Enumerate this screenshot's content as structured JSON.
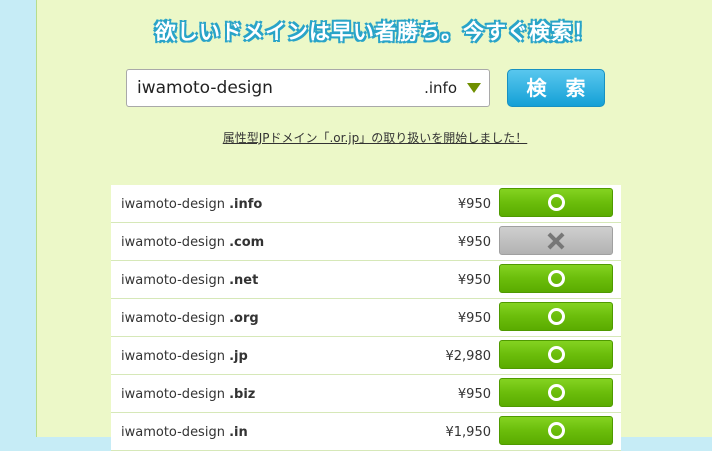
{
  "headline": "欲しいドメインは早い者勝ち。今すぐ検索！",
  "search": {
    "value": "iwamoto-design",
    "selected_tld": ".info",
    "button_label": "検 索"
  },
  "notice_link": "属性型JPドメイン「.or.jp」の取り扱いを開始しました！",
  "results": [
    {
      "name": "iwamoto-design",
      "tld": ".info",
      "price": "¥950",
      "available": true
    },
    {
      "name": "iwamoto-design",
      "tld": ".com",
      "price": "¥950",
      "available": false
    },
    {
      "name": "iwamoto-design",
      "tld": ".net",
      "price": "¥950",
      "available": true
    },
    {
      "name": "iwamoto-design",
      "tld": ".org",
      "price": "¥950",
      "available": true
    },
    {
      "name": "iwamoto-design",
      "tld": ".jp",
      "price": "¥2,980",
      "available": true
    },
    {
      "name": "iwamoto-design",
      "tld": ".biz",
      "price": "¥950",
      "available": true
    },
    {
      "name": "iwamoto-design",
      "tld": ".in",
      "price": "¥1,950",
      "available": true
    }
  ],
  "icons": {
    "available": "circle-icon",
    "unavailable": "cross-icon"
  },
  "colors": {
    "available": "#6bbd0b",
    "unavailable": "#b8b8b8",
    "button": "#14a0d6",
    "panel": "#ecf8c8",
    "background": "#c6ecf6"
  }
}
